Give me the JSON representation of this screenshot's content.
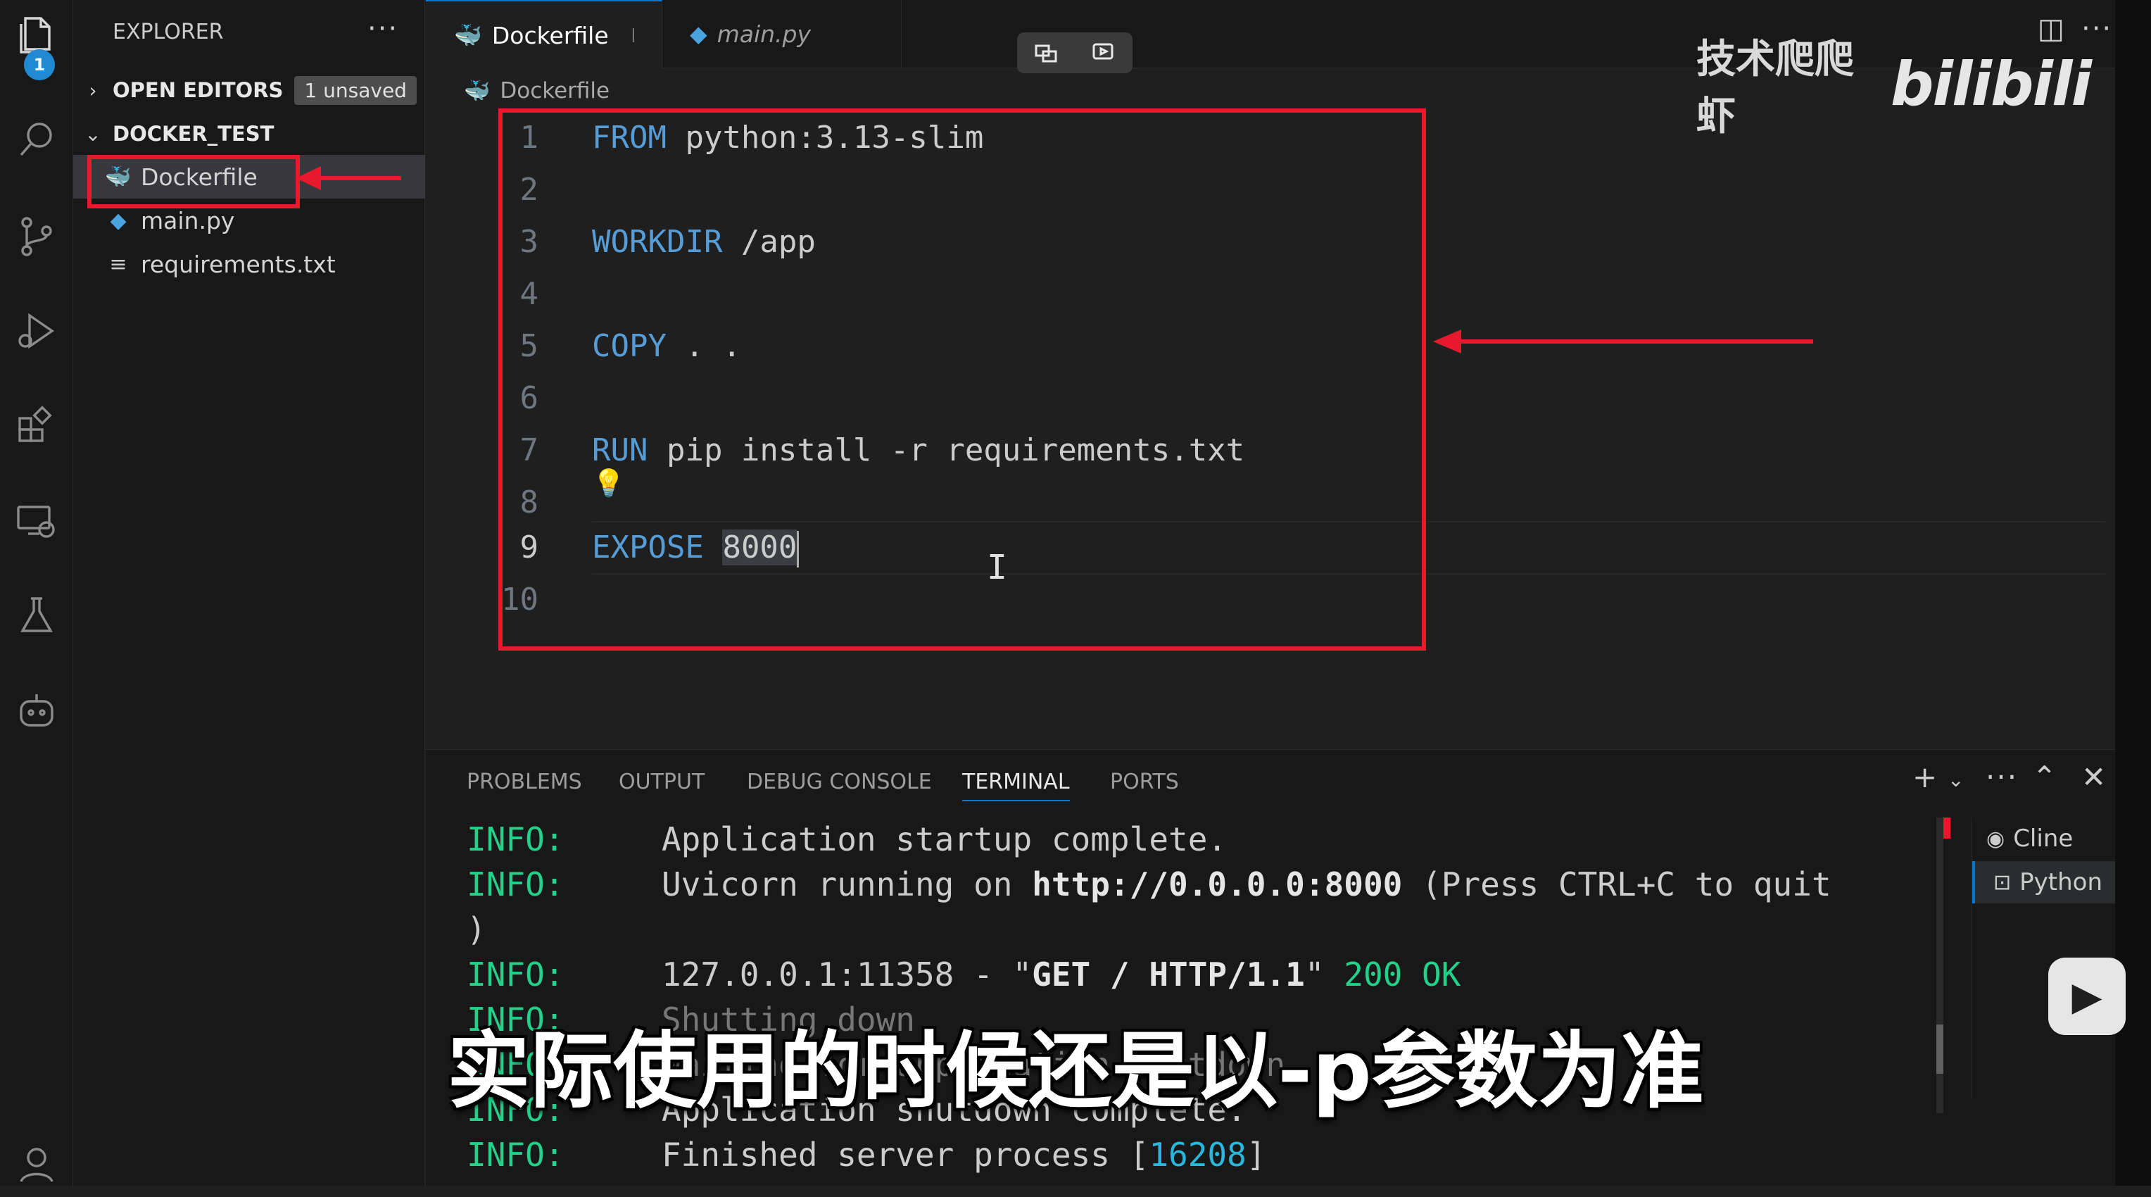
{
  "activity_bar": {
    "explorer_badge": "1",
    "items": [
      "files-icon",
      "search-icon",
      "source-control-icon",
      "run-debug-icon",
      "extensions-icon",
      "remote-explorer-icon",
      "testing-icon",
      "copilot-icon",
      "account-icon"
    ]
  },
  "sidebar": {
    "title": "EXPLORER",
    "more": "···",
    "open_editors": {
      "label": "OPEN EDITORS",
      "badge": "1 unsaved"
    },
    "folder": {
      "label": "DOCKER_TEST"
    },
    "files": [
      {
        "name": "Dockerfile",
        "icon": "docker-icon"
      },
      {
        "name": "main.py",
        "icon": "python-icon"
      },
      {
        "name": "requirements.txt",
        "icon": "text-file-icon"
      }
    ]
  },
  "tabs": [
    {
      "label": "Dockerfile",
      "dirty": true
    },
    {
      "label": "main.py",
      "dirty": false
    }
  ],
  "breadcrumb": "Dockerfile",
  "editor": {
    "lines": [
      {
        "n": "1",
        "kw": "FROM",
        "rest": " python:3.13-slim"
      },
      {
        "n": "2",
        "kw": "",
        "rest": ""
      },
      {
        "n": "3",
        "kw": "WORKDIR",
        "rest": " /app"
      },
      {
        "n": "4",
        "kw": "",
        "rest": ""
      },
      {
        "n": "5",
        "kw": "COPY",
        "rest": " . ."
      },
      {
        "n": "6",
        "kw": "",
        "rest": ""
      },
      {
        "n": "7",
        "kw": "RUN",
        "rest": " pip install -r requirements.txt"
      },
      {
        "n": "8",
        "kw": "",
        "rest": ""
      },
      {
        "n": "9",
        "kw": "EXPOSE",
        "rest": " ",
        "selected": "8000"
      },
      {
        "n": "10",
        "kw": "",
        "rest": ""
      }
    ],
    "current_line": "9"
  },
  "watermark": {
    "text": "技术爬爬虾",
    "logo": "bilibili"
  },
  "panel": {
    "tabs": [
      "PROBLEMS",
      "OUTPUT",
      "DEBUG CONSOLE",
      "TERMINAL",
      "PORTS"
    ],
    "active_tab": "TERMINAL",
    "terminal_lines": [
      {
        "level": "INFO:",
        "text": "     Application startup complete."
      },
      {
        "level": "INFO:",
        "pre": "     Uvicorn running on ",
        "bold": "http://0.0.0.0:8000",
        "post": " (Press CTRL+C to quit"
      },
      {
        "level": "",
        "text": ")"
      },
      {
        "level": "INFO:",
        "pre": "     127.0.0.1:11358 - \"",
        "bold": "GET / HTTP/1.1",
        "post": "\" ",
        "ok": "200 OK"
      },
      {
        "level": "INFO:",
        "text": "     Shutting down"
      },
      {
        "level": "INFO:",
        "text": "     Waiting for application shutdown."
      },
      {
        "level": "INFO:",
        "text": "     Application shutdown complete."
      },
      {
        "level": "INFO:",
        "pre": "     Finished server process [",
        "num": "16208",
        "post": "]"
      }
    ],
    "terminals": [
      {
        "name": "Cline",
        "icon": "robot-icon"
      },
      {
        "name": "Python",
        "icon": "terminal-icon"
      }
    ]
  },
  "subtitle": "实际使用的时候还是以-p参数为准"
}
